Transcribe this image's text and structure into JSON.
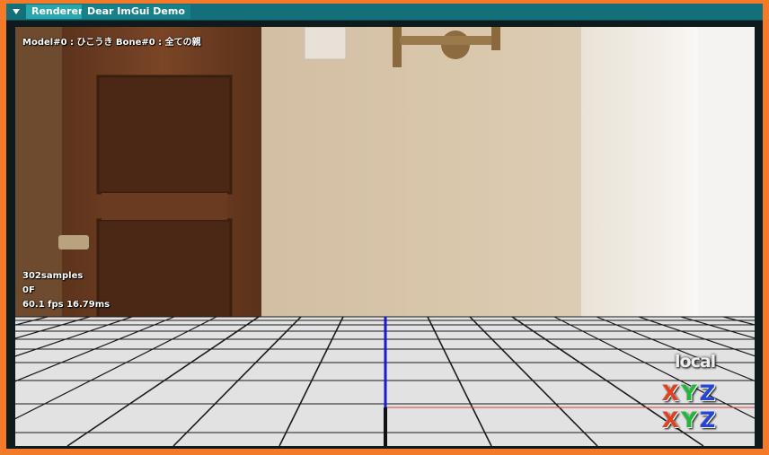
{
  "tabs": [
    {
      "label": "Renderer",
      "active": true
    },
    {
      "label": "Dear ImGui Demo",
      "active": false
    }
  ],
  "overlay": {
    "model_info": "Model#0 : ひこうき Bone#0 : 全ての親",
    "samples": "302samples",
    "frame": "0F",
    "fps": "60.1 fps 16.79ms"
  },
  "gizmo": {
    "space_label": "local",
    "axes": [
      "X",
      "Y",
      "Z"
    ],
    "axis_colors": {
      "X": "#e0401e",
      "Y": "#1fb83a",
      "Z": "#2645d8"
    }
  },
  "colors": {
    "border": "#f47a2a",
    "tabbar": "#13707a",
    "tab_active": "#2aa6ae",
    "grid_floor": "#e2e2e2",
    "axis_y_line": "#1a1ad0",
    "axis_x_line": "#d04040"
  }
}
